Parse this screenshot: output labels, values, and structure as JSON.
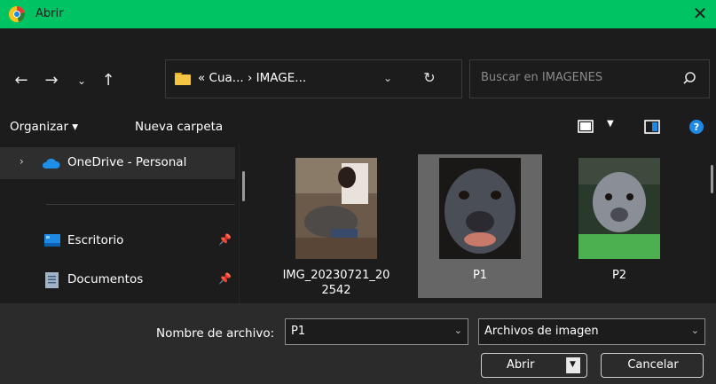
{
  "window": {
    "title": "Abrir",
    "accent": "#00c463"
  },
  "nav": {
    "back_icon": "arrow-left-icon",
    "forward_icon": "arrow-right-icon",
    "recent_icon": "chevron-down-icon",
    "up_icon": "arrow-up-icon",
    "address": "« Cua... › IMAGE...",
    "search_placeholder": "Buscar en IMAGENES"
  },
  "toolbar": {
    "organize": "Organizar ▾",
    "new_folder": "Nueva carpeta"
  },
  "sidebar": {
    "items": [
      {
        "label": "OneDrive - Personal"
      },
      {
        "label": "Escritorio"
      },
      {
        "label": "Documentos"
      }
    ]
  },
  "files": [
    {
      "name": "IMG_20230721_20\n2542"
    },
    {
      "name": "P1"
    },
    {
      "name": "P2"
    }
  ],
  "bottom": {
    "filename_label": "Nombre de archivo:",
    "filename_value": "P1",
    "filetype_value": "Archivos de imagen",
    "open_label": "Abrir",
    "cancel_label": "Cancelar"
  }
}
